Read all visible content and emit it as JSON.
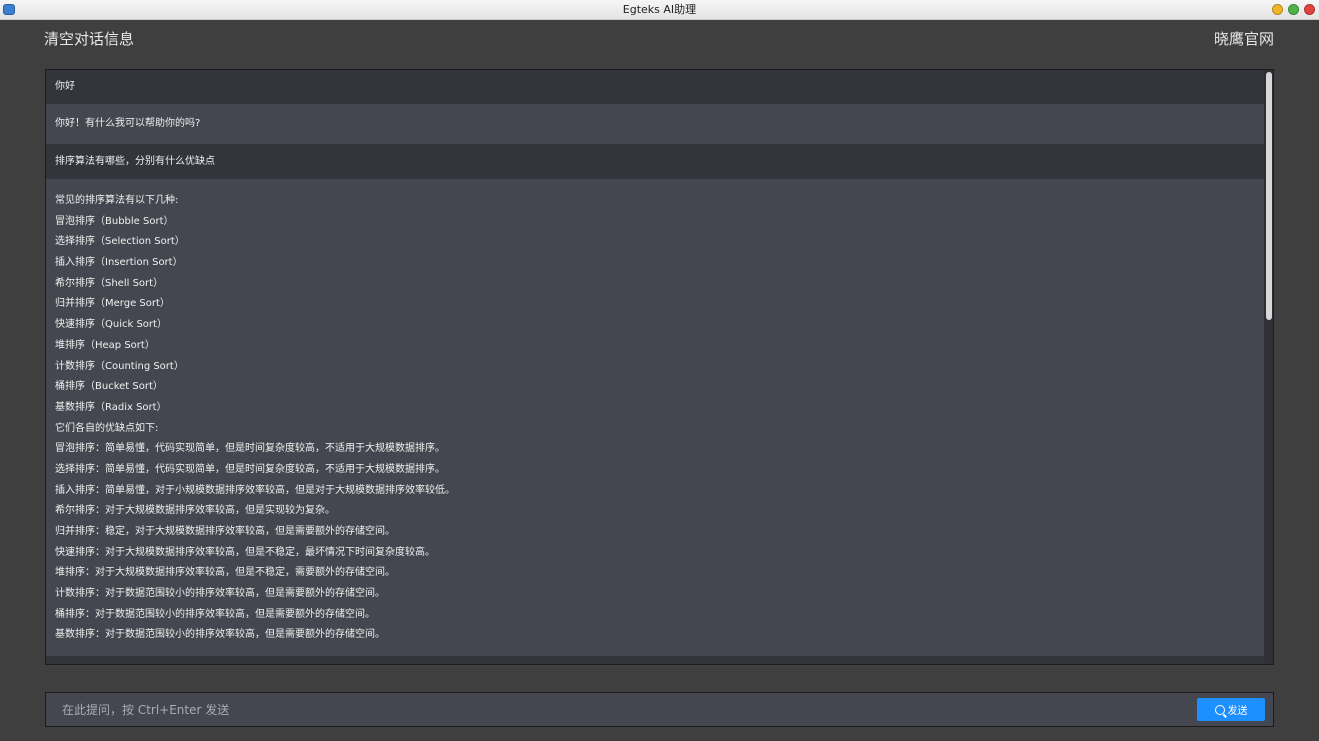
{
  "window": {
    "title": "Egteks AI助理"
  },
  "header": {
    "clear_label": "清空对话信息",
    "site_link": "晓鹰官网"
  },
  "messages": [
    {
      "role": "user",
      "text": "你好"
    },
    {
      "role": "assistant",
      "text": "你好！有什么我可以帮助你的吗?"
    },
    {
      "role": "user",
      "text": "排序算法有哪些，分别有什么优缺点"
    },
    {
      "role": "assistant",
      "lines": [
        "常见的排序算法有以下几种:",
        "冒泡排序（Bubble Sort）",
        "选择排序（Selection Sort）",
        "插入排序（Insertion Sort）",
        "希尔排序（Shell Sort）",
        "归并排序（Merge Sort）",
        "快速排序（Quick Sort）",
        "堆排序（Heap Sort）",
        "计数排序（Counting Sort）",
        "桶排序（Bucket Sort）",
        "基数排序（Radix Sort）",
        "它们各自的优缺点如下:",
        "冒泡排序：简单易懂，代码实现简单，但是时间复杂度较高，不适用于大规模数据排序。",
        "选择排序：简单易懂，代码实现简单，但是时间复杂度较高，不适用于大规模数据排序。",
        "插入排序：简单易懂，对于小规模数据排序效率较高，但是对于大规模数据排序效率较低。",
        "希尔排序：对于大规模数据排序效率较高，但是实现较为复杂。",
        "归并排序：稳定，对于大规模数据排序效率较高，但是需要额外的存储空间。",
        "快速排序：对于大规模数据排序效率较高，但是不稳定，最坏情况下时间复杂度较高。",
        "堆排序：对于大规模数据排序效率较高，但是不稳定，需要额外的存储空间。",
        "计数排序：对于数据范围较小的排序效率较高，但是需要额外的存储空间。",
        "桶排序：对于数据范围较小的排序效率较高，但是需要额外的存储空间。",
        "基数排序：对于数据范围较小的排序效率较高，但是需要额外的存储空间。"
      ]
    }
  ],
  "input": {
    "placeholder": "在此提问，按 Ctrl+Enter 发送",
    "value": ""
  },
  "send_button": {
    "label": "发送"
  },
  "colors": {
    "background": "#3f3f3f",
    "user_message_bg": "#33353d",
    "assistant_message_bg": "#44474f",
    "send_button": "#1e8fff"
  },
  "icons": {
    "send": "search-icon"
  }
}
